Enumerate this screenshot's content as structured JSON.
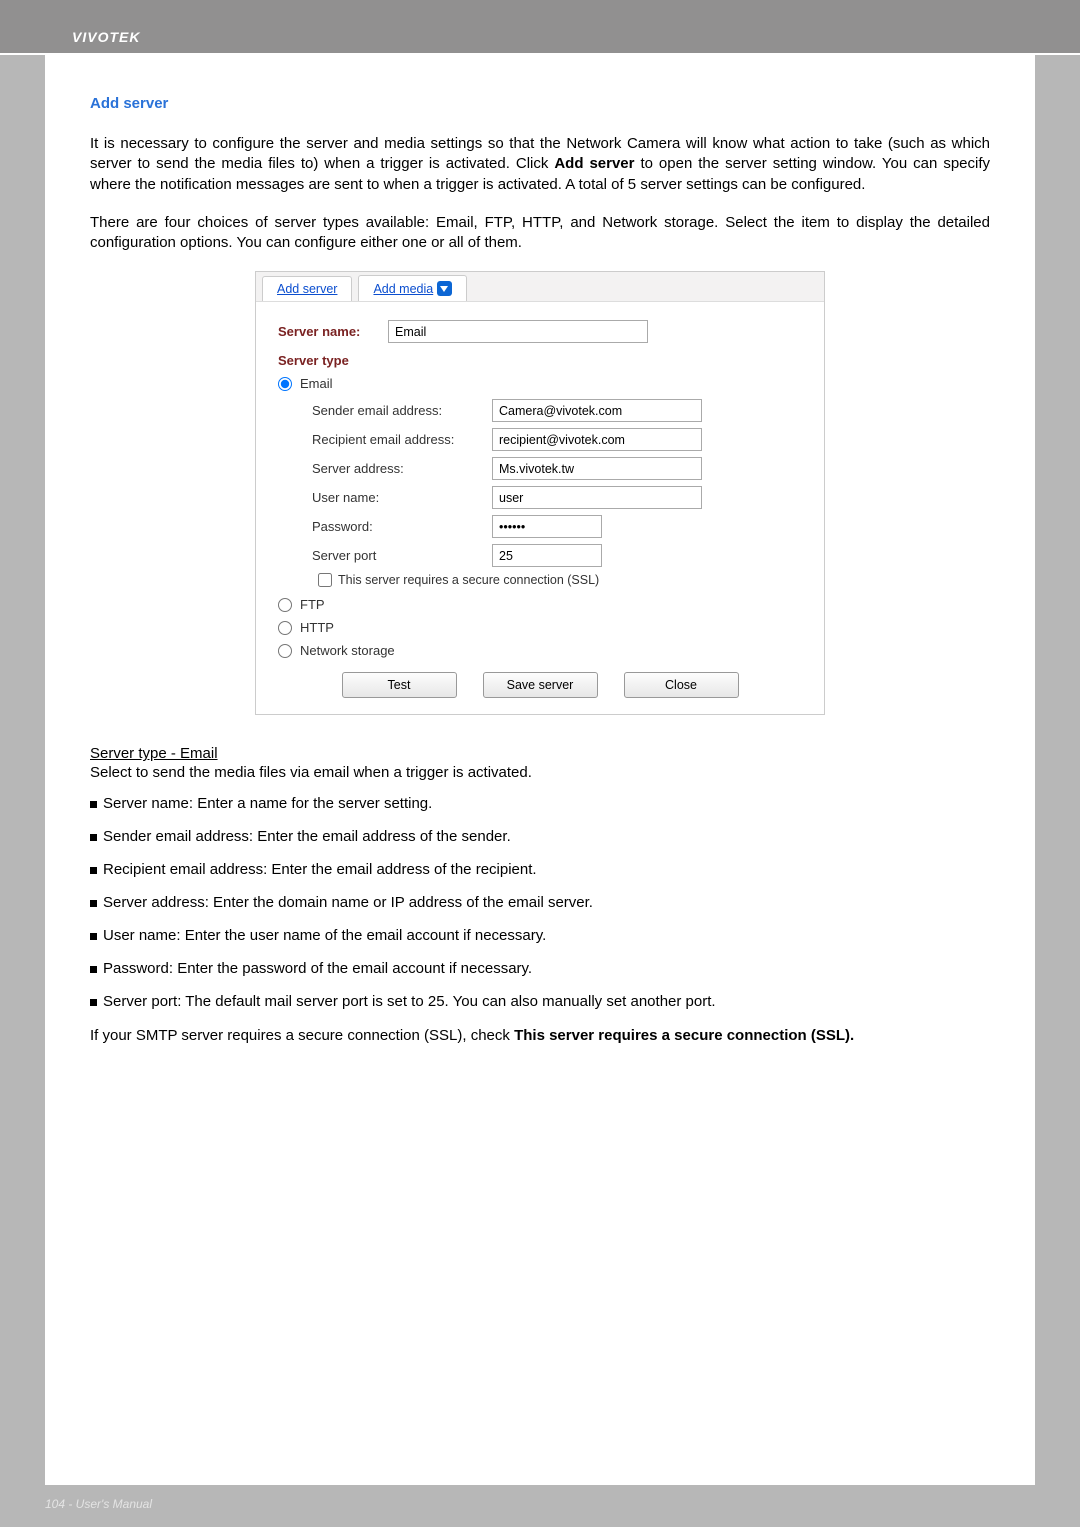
{
  "brand": "VIVOTEK",
  "section_title": "Add server",
  "paragraphs": {
    "p1a": "It is necessary to configure the server and media settings so that the Network Camera will know what action to take (such as which server to send the media files to) when a trigger is activated. Click ",
    "p1b": "Add server",
    "p1c": " to open the server setting window. You can specify where the notification messages are sent to when a trigger is activated. A total of 5 server settings can be configured.",
    "p2": "There are four choices of server types available: Email, FTP, HTTP, and Network storage. Select the item to display the detailed configuration options. You can configure either one or all of them."
  },
  "panel": {
    "tab1": "Add server",
    "tab2": "Add media",
    "server_name_label": "Server name:",
    "server_name_value": "Email",
    "server_type_label": "Server type",
    "radio_email": "Email",
    "radio_ftp": "FTP",
    "radio_http": "HTTP",
    "radio_network": "Network storage",
    "fields": {
      "sender_label": "Sender email address:",
      "sender_value": "Camera@vivotek.com",
      "recipient_label": "Recipient email address:",
      "recipient_value": "recipient@vivotek.com",
      "server_addr_label": "Server address:",
      "server_addr_value": "Ms.vivotek.tw",
      "username_label": "User name:",
      "username_value": "user",
      "password_label": "Password:",
      "password_value": "••••••",
      "port_label": "Server port",
      "port_value": "25",
      "ssl_label": "This server requires a secure connection (SSL)"
    },
    "buttons": {
      "test": "Test",
      "save": "Save server",
      "close": "Close"
    }
  },
  "email_section": {
    "heading": "Server type - Email",
    "intro": "Select to send the media files via email when a trigger is activated.",
    "bullets": [
      "Server name: Enter a name for the server setting.",
      "Sender email address: Enter the email address of the sender.",
      "Recipient email address: Enter the email address of the recipient.",
      "Server address: Enter the domain name or IP address of the email server.",
      "User name: Enter the user name of the email account if necessary.",
      "Password: Enter the password of the email account if necessary.",
      "Server port: The default mail server port is set to 25. You can also manually set another port."
    ],
    "closing_a": "If your SMTP server requires a secure connection (SSL), check ",
    "closing_b": "This server requires a secure connection (SSL)."
  },
  "footer": "104 - User's Manual"
}
